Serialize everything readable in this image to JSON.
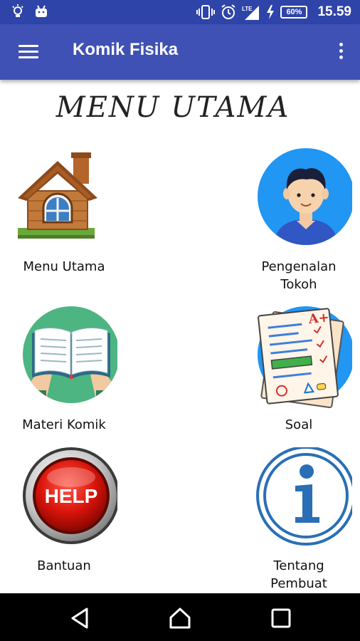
{
  "status_bar": {
    "time": "15.59",
    "battery": "60%",
    "icons": [
      "bulb-icon",
      "android-icon",
      "vibrate-icon",
      "alarm-icon",
      "lte-signal-icon",
      "charging-icon",
      "battery-icon"
    ]
  },
  "app_bar": {
    "title": "Komik Fisika",
    "menu_icon": "hamburger-icon",
    "overflow_icon": "more-vert-icon"
  },
  "heading": "MENU UTAMA",
  "menu": {
    "items": [
      {
        "label": "Menu Utama",
        "icon": "house-icon"
      },
      {
        "label": "Pengenalan\nTokoh",
        "icon": "avatar-icon"
      },
      {
        "label": "Materi Komik",
        "icon": "open-book-icon"
      },
      {
        "label": "Soal",
        "icon": "test-paper-icon"
      },
      {
        "label": "Bantuan",
        "icon": "help-button-icon"
      },
      {
        "label": "Tentang\nPembuat",
        "icon": "info-icon"
      }
    ],
    "help_text": "HELP",
    "grade_text": "A+"
  },
  "nav_bar": {
    "back_icon": "back-icon",
    "home_icon": "home-icon",
    "recents_icon": "recents-icon"
  },
  "colors": {
    "status_bar": "#2f44a8",
    "app_bar": "#3f51b5",
    "nav_bar": "#000000"
  }
}
